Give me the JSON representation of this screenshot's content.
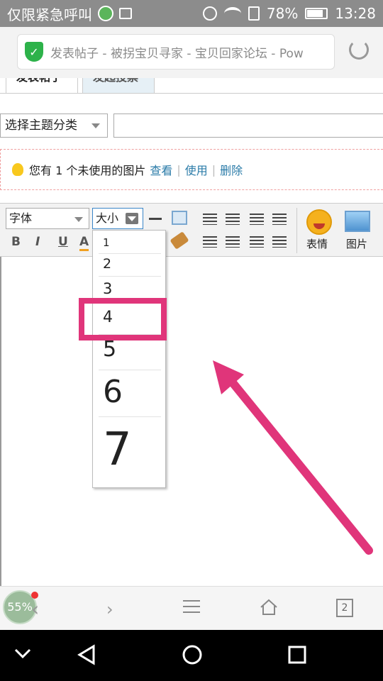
{
  "status_bar": {
    "carrier": "仅限紧急呼叫",
    "battery": "78%",
    "time": "13:28"
  },
  "browser": {
    "url_title": "发表帖子 - 被拐宝贝寻家 - 宝贝回家论坛 - Pow",
    "progress": "55%",
    "tab_count": "2"
  },
  "tabs": [
    {
      "label": "发表帖子"
    },
    {
      "label": "发起投票"
    }
  ],
  "category": {
    "selected": "选择主题分类"
  },
  "notice": {
    "text": "您有 1 个未使用的图片",
    "view": "查看",
    "use": "使用",
    "delete": "删除",
    "sep": "|"
  },
  "toolbar": {
    "font_label": "字体",
    "size_label": "大小",
    "emoji_label": "表情",
    "image_label": "图片",
    "bold": "B",
    "italic": "I",
    "underline": "U",
    "color": "A"
  },
  "size_dropdown": {
    "options": [
      "1",
      "2",
      "3",
      "4",
      "5",
      "6",
      "7"
    ],
    "highlighted": "4"
  },
  "colors": {
    "accent_pink": "#e0357a",
    "link": "#2a7ba8",
    "shield_green": "#2db24a"
  }
}
